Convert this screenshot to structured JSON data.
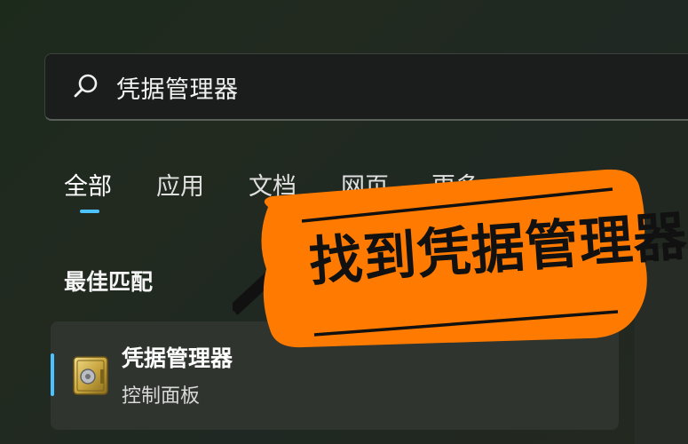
{
  "search": {
    "query": "凭据管理器"
  },
  "tabs": [
    {
      "label": "全部",
      "active": true
    },
    {
      "label": "应用",
      "active": false
    },
    {
      "label": "文档",
      "active": false
    },
    {
      "label": "网页",
      "active": false
    },
    {
      "label": "更多",
      "active": false
    }
  ],
  "best_match": {
    "section_label": "最佳匹配",
    "result": {
      "title": "凭据管理器",
      "subtitle": "控制面板",
      "icon": "credential-manager-safe-icon"
    }
  },
  "annotation": {
    "text": "找到凭据管理器",
    "color": "#ff7a00"
  },
  "colors": {
    "accent": "#4cc2ff",
    "callout": "#ff7a00"
  }
}
